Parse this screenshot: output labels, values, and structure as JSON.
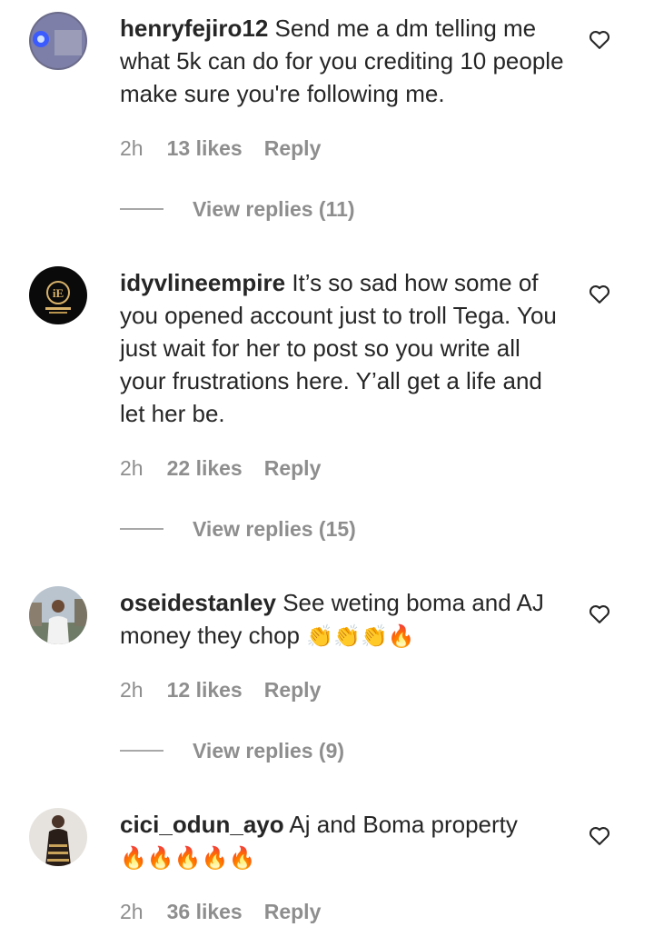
{
  "comments": [
    {
      "username": "henryfejiro12",
      "text": "Send me a dm telling me what 5k can do for you crediting 10 people make sure you're following me.",
      "time": "2h",
      "likes": "13 likes",
      "reply": "Reply",
      "view_replies": "View replies (11)"
    },
    {
      "username": "idyvlineempire",
      "text": "It’s so sad how some of you opened account just to troll Tega. You just wait for her to post so you write all your frustrations here. Y’all get a life and let her be.",
      "time": "2h",
      "likes": "22 likes",
      "reply": "Reply",
      "view_replies": "View replies (15)"
    },
    {
      "username": "oseidestanley",
      "text": "See weting boma and AJ money they chop",
      "emojis": "👏👏👏🔥",
      "time": "2h",
      "likes": "12 likes",
      "reply": "Reply",
      "view_replies": "View replies (9)"
    },
    {
      "username": "cici_odun_ayo",
      "text": "Aj and Boma property",
      "emojis": "🔥🔥🔥🔥🔥",
      "time": "2h",
      "likes": "36 likes",
      "reply": "Reply"
    }
  ],
  "icons": {
    "like": "heart-icon",
    "avatar": "avatar"
  },
  "colors": {
    "text": "#262626",
    "secondary": "#8e8e8e"
  }
}
